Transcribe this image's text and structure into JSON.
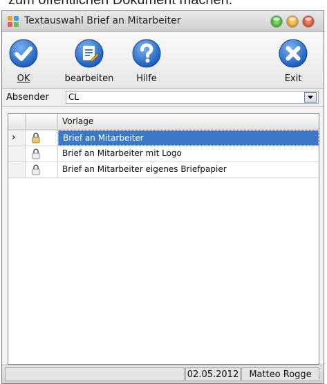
{
  "page_caption": "zum öffentlichen Dokument machen.",
  "window": {
    "title": "Textauswahl Brief an Mitarbeiter",
    "controls": [
      "minimize",
      "maximize",
      "close"
    ]
  },
  "colors": {
    "accent_blue": "#1f6fd0",
    "selection": "#3b78c8",
    "win_green": "#3bc03b",
    "win_yellow": "#f5a623",
    "win_red": "#e0442c"
  },
  "toolbar": {
    "ok_label": "OK",
    "ok_icon": "checkmark-icon",
    "edit_label": "bearbeiten",
    "edit_icon": "edit-document-icon",
    "help_label": "Hilfe",
    "help_icon": "question-icon",
    "exit_label": "Exit",
    "exit_icon": "close-icon"
  },
  "absender": {
    "label": "Absender",
    "value": "CL"
  },
  "grid": {
    "columns": [
      "",
      "",
      "Vorlage"
    ],
    "rows": [
      {
        "vorlage": "Brief an Mitarbeiter",
        "selected": true
      },
      {
        "vorlage": "Brief an Mitarbeiter mit Logo",
        "selected": false
      },
      {
        "vorlage": "Brief an Mitarbeiter eigenes Briefpapier",
        "selected": false
      }
    ]
  },
  "status": {
    "date": "02.05.2012",
    "user": "Matteo Rogge"
  }
}
